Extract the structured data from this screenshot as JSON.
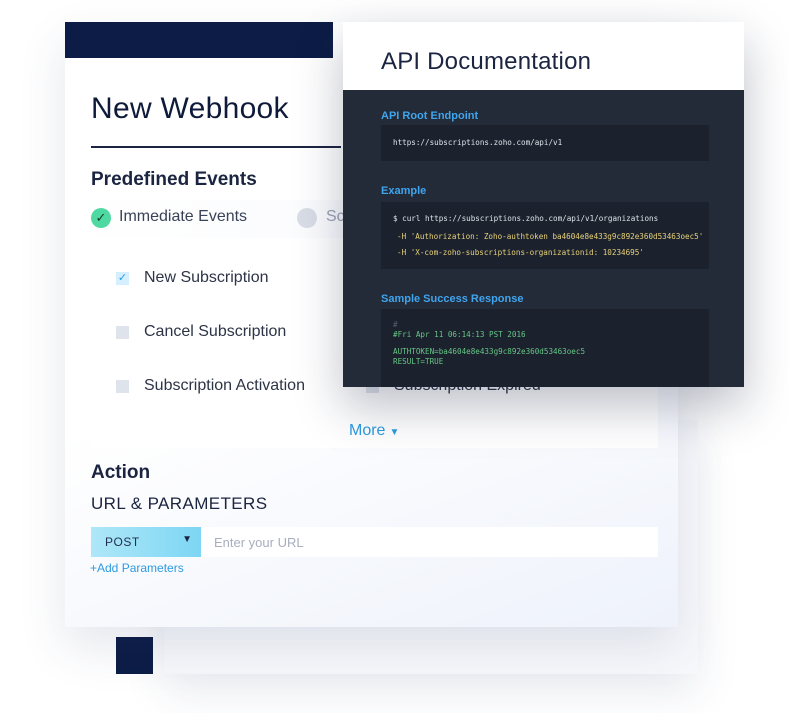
{
  "webhook": {
    "title": "New Webhook",
    "predefined_events_heading": "Predefined Events",
    "event_types": [
      {
        "label": "Immediate Events",
        "selected": true
      },
      {
        "label": "Sc",
        "selected": false
      }
    ],
    "options": [
      {
        "label": "New Subscription",
        "checked": true
      },
      {
        "label": "Cancel Subscription",
        "checked": false
      },
      {
        "label": "Subscription Activation",
        "checked": false
      },
      {
        "label": "Subscription Expired",
        "checked": false
      }
    ],
    "more_label": "More",
    "action_heading": "Action",
    "url_params_heading": "URL & PARAMETERS",
    "method": "POST",
    "url_placeholder": "Enter your URL",
    "add_params_label": "+Add Parameters"
  },
  "api_doc": {
    "title": "API Documentation",
    "root_endpoint_label": "API Root Endpoint",
    "root_endpoint_value": "https://subscriptions.zoho.com/api/v1",
    "example_label": "Example",
    "example_lines": [
      "$ curl https://subscriptions.zoho.com/api/v1/organizations",
      "-H 'Authorization: Zoho-authtoken ba4604e8e433g9c892e360d53463oec5'",
      "-H 'X-com-zoho-subscriptions-organizationid: 10234695'"
    ],
    "response_label": "Sample Success Response",
    "response_lines": [
      "#",
      "#Fri Apr 11 06:14:13 PST 2016",
      "AUTHTOKEN=ba4604e8e433g9c892e360d53463oec5",
      "RESULT=TRUE"
    ]
  },
  "colors": {
    "navy": "#0c1c46",
    "accent_blue": "#2d9be0",
    "success_green": "#4fd9a2",
    "code_bg": "#232a38"
  }
}
